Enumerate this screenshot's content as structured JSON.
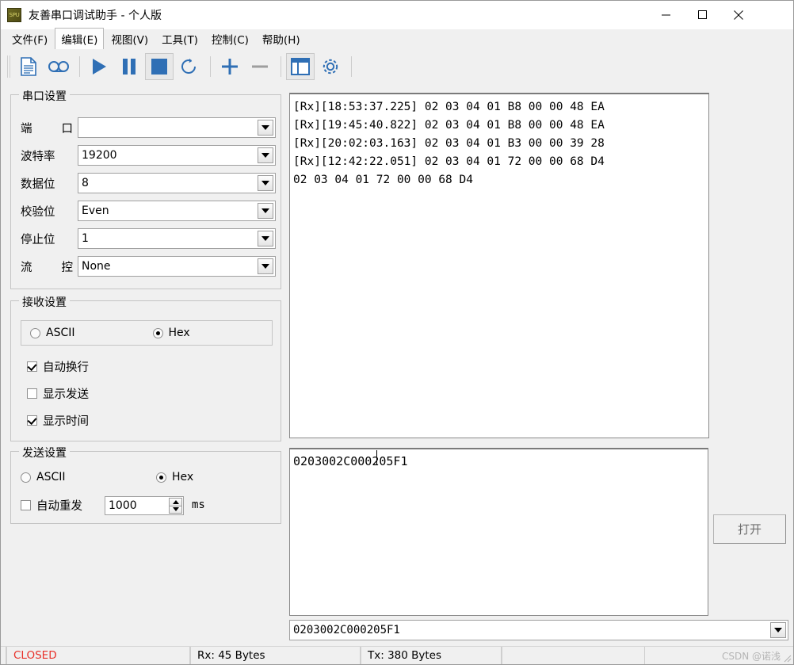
{
  "window": {
    "title": "友善串口调试助手 - 个人版",
    "app_icon_label": "SPU",
    "minimize_label": "−",
    "maximize_label": "□",
    "close_label": "✕"
  },
  "menubar": {
    "items": [
      {
        "label": "文件(F)",
        "accel": "F",
        "text": "文件(",
        "tail": ")",
        "active": false
      },
      {
        "label": "编辑(E)",
        "accel": "E",
        "text": "编辑(",
        "tail": ")",
        "active": true
      },
      {
        "label": "视图(V)",
        "accel": "V",
        "text": "视图(",
        "tail": ")",
        "active": false
      },
      {
        "label": "工具(T)",
        "accel": "T",
        "text": "工具(",
        "tail": ")",
        "active": false
      },
      {
        "label": "控制(C)",
        "accel": "C",
        "text": "控制(",
        "tail": ")",
        "active": false
      },
      {
        "label": "帮助(H)",
        "accel": "H",
        "text": "帮助(",
        "tail": ")",
        "active": false
      }
    ]
  },
  "toolbar": {
    "buttons": [
      {
        "icon": "new-file-icon",
        "checked": false
      },
      {
        "icon": "record-icon",
        "checked": false
      },
      {
        "icon": "play-icon",
        "checked": false
      },
      {
        "icon": "pause-icon",
        "checked": false
      },
      {
        "icon": "stop-icon",
        "checked": true
      },
      {
        "icon": "refresh-icon",
        "checked": false
      },
      {
        "icon": "plus-icon",
        "checked": false
      },
      {
        "icon": "minus-icon",
        "checked": false
      },
      {
        "icon": "window-layout-icon",
        "checked": true
      },
      {
        "icon": "gear-icon",
        "checked": false
      }
    ],
    "accent_color": "#2f6fb5",
    "disabled_color": "#9e9e9e"
  },
  "serial_settings": {
    "title": "串口设置",
    "fields": [
      {
        "name": "port",
        "label_a": "端",
        "label_b": "口",
        "spread": true,
        "value": ""
      },
      {
        "name": "baudrate",
        "label_a": "波特率",
        "label_b": "",
        "spread": false,
        "value": "19200"
      },
      {
        "name": "databits",
        "label_a": "数据位",
        "label_b": "",
        "spread": false,
        "value": "8"
      },
      {
        "name": "parity",
        "label_a": "校验位",
        "label_b": "",
        "spread": false,
        "value": "Even"
      },
      {
        "name": "stopbits",
        "label_a": "停止位",
        "label_b": "",
        "spread": false,
        "value": "1"
      },
      {
        "name": "flowctrl",
        "label_a": "流",
        "label_b": "控",
        "spread": true,
        "value": "None"
      }
    ]
  },
  "receive_settings": {
    "title": "接收设置",
    "format": {
      "ascii_label": "ASCII",
      "hex_label": "Hex",
      "selected": "Hex"
    },
    "checkboxes": [
      {
        "label": "自动换行",
        "checked": true
      },
      {
        "label": "显示发送",
        "checked": false
      },
      {
        "label": "显示时间",
        "checked": true
      }
    ]
  },
  "send_settings": {
    "title": "发送设置",
    "format": {
      "ascii_label": "ASCII",
      "hex_label": "Hex",
      "selected": "Hex"
    },
    "auto_resend": {
      "label": "自动重发",
      "checked": false,
      "interval": "1000",
      "unit": "ms"
    }
  },
  "receive_area": {
    "lines": [
      "[Rx][18:53:37.225] 02 03 04 01 B8 00 00 48 EA",
      "[Rx][19:45:40.822] 02 03 04 01 B8 00 00 48 EA",
      "[Rx][20:02:03.163] 02 03 04 01 B3 00 00 39 28",
      "[Rx][12:42:22.051] 02 03 04 01 72 00 00 68 D4",
      "02 03 04 01 72 00 00 68 D4"
    ]
  },
  "send_area": {
    "value": "0203002C000205F1"
  },
  "history_combo": {
    "value": "0203002C000205F1"
  },
  "open_button": {
    "label": "打开",
    "enabled": false
  },
  "statusbar": {
    "connection": "CLOSED",
    "connection_color": "#e8312a",
    "rx": "Rx: 45 Bytes",
    "tx": "Tx: 380 Bytes",
    "blank": "",
    "watermark": "CSDN @诺浅"
  }
}
